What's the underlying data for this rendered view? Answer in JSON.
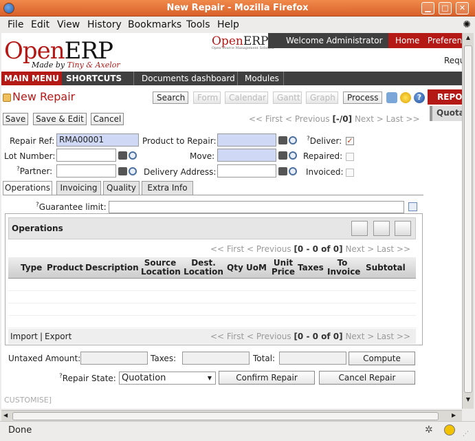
{
  "window": {
    "title": "New Repair - Mozilla Firefox"
  },
  "menubar": [
    "File",
    "Edit",
    "View",
    "History",
    "Bookmarks",
    "Tools",
    "Help"
  ],
  "header": {
    "logo_open": "Open",
    "logo_erp": "ERP",
    "made_by_prefix": "Made by",
    "made_by_names": "Tiny & Axelor",
    "logo2_open": "Open",
    "logo2_erp": "ERP",
    "logo2_sub": "Open Source Management Solution",
    "welcome": "Welcome Administrator",
    "home": "Home",
    "preferences": "Preferen",
    "requests": "Requ"
  },
  "nav": {
    "main_menu": "MAIN MENU",
    "shortcuts": "SHORTCUTS",
    "items": [
      "Documents dashboard",
      "Modules"
    ]
  },
  "page": {
    "title": "New Repair"
  },
  "view_buttons": {
    "search": "Search",
    "form": "Form",
    "calendar": "Calendar",
    "gantt": "Gantt",
    "graph": "Graph",
    "process": "Process"
  },
  "side": {
    "reports": "REPO",
    "quotation": "Quota"
  },
  "actions": {
    "save": "Save",
    "save_edit": "Save & Edit",
    "cancel": "Cancel"
  },
  "pager_top": {
    "first": "<< First",
    "previous": "< Previous",
    "count": "[-/0]",
    "next": "Next >",
    "last": "Last >>"
  },
  "form": {
    "repair_ref_label": "Repair Ref:",
    "repair_ref": "RMA00001",
    "product_label": "Product to Repair:",
    "deliver_label": "Deliver:",
    "lot_label": "Lot Number:",
    "move_label": "Move:",
    "repaired_label": "Repaired:",
    "partner_label": "Partner:",
    "delivery_address_label": "Delivery Address:",
    "invoiced_label": "Invoiced:",
    "help_mark": "?"
  },
  "tabs": [
    "Operations",
    "Invoicing",
    "Quality",
    "Extra Info"
  ],
  "guarantee_label": "Guarantee limit:",
  "operations": {
    "title": "Operations",
    "pager": {
      "first": "<< First",
      "previous": "< Previous",
      "count": "[0 - 0 of 0]",
      "next": "Next >",
      "last": "Last >>"
    },
    "columns": [
      "Type",
      "Product",
      "Description",
      "Source Location",
      "Dest. Location",
      "Qty",
      "UoM",
      "Unit Price",
      "Taxes",
      "To Invoice",
      "Subtotal"
    ],
    "import": "Import",
    "export": "Export",
    "separator": "|"
  },
  "totals": {
    "untaxed_label": "Untaxed Amount:",
    "taxes_label": "Taxes:",
    "total_label": "Total:",
    "compute": "Compute"
  },
  "state": {
    "label": "Repair State:",
    "value": "Quotation",
    "confirm": "Confirm Repair",
    "cancel": "Cancel Repair"
  },
  "customise": "CUSTOMISE]",
  "statusbar": {
    "text": "Done"
  },
  "colors": {
    "brand": "#b51916",
    "dark_bar": "#3f3f3f",
    "required_field": "#cfd9f5"
  }
}
